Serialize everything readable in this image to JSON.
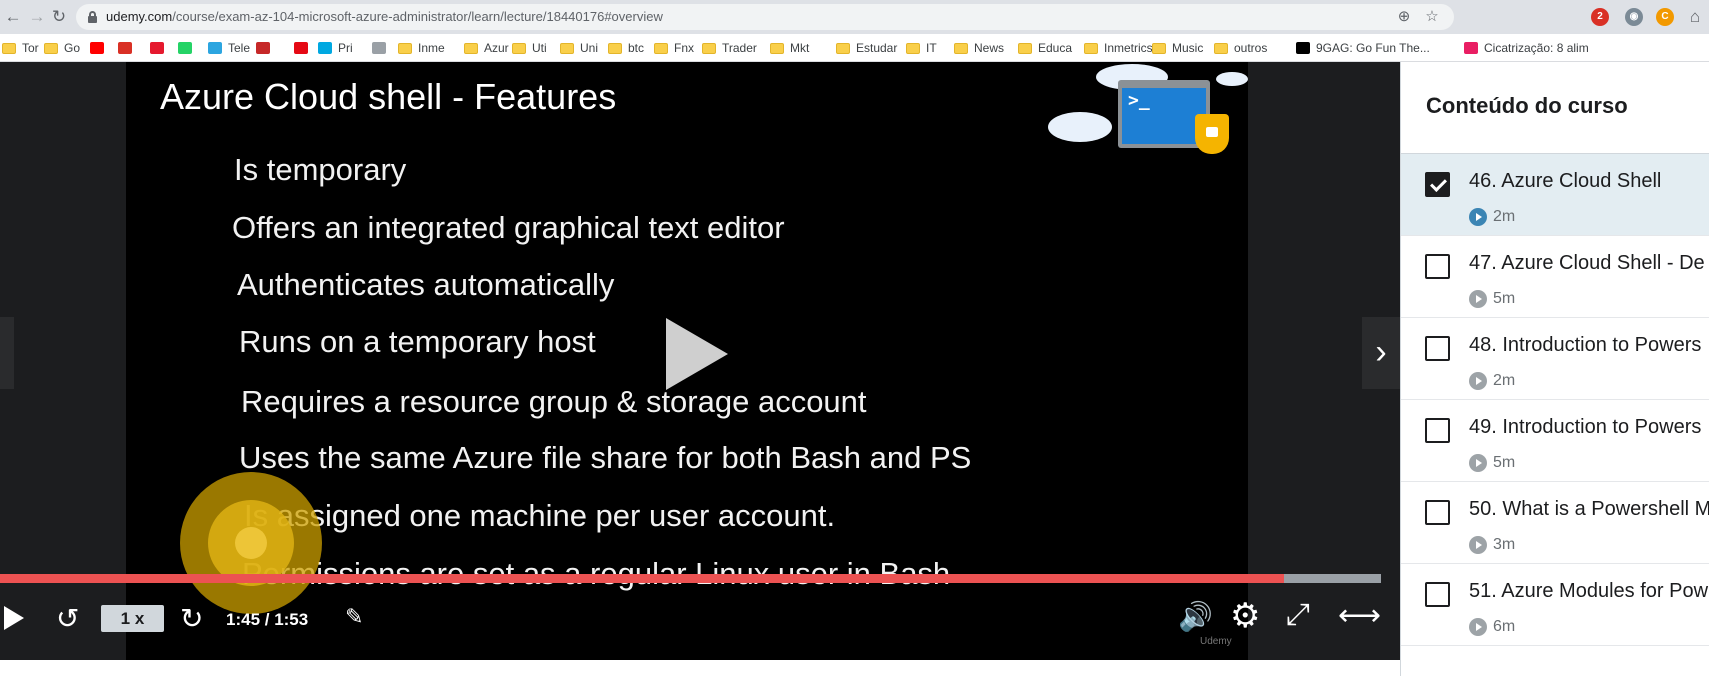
{
  "browser": {
    "url_host": "udemy.com",
    "url_path": "/course/exam-az-104-microsoft-azure-administrator/learn/lecture/18440176#overview",
    "extension_badge": "2",
    "bookmarks": [
      {
        "label": "Tor",
        "icon": "folder"
      },
      {
        "label": "Go",
        "icon": "folder"
      },
      {
        "label": "",
        "icon": "youtube-icon"
      },
      {
        "label": "",
        "icon": "gmail-icon"
      },
      {
        "label": "",
        "icon": "video-icon"
      },
      {
        "label": "",
        "icon": "whatsapp-icon"
      },
      {
        "label": "Tele",
        "icon": "telegram-icon"
      },
      {
        "label": "",
        "icon": "simple-fx-icon"
      },
      {
        "label": "",
        "icon": "netflix-icon"
      },
      {
        "label": "Pri",
        "icon": "prime-icon"
      },
      {
        "label": "",
        "icon": "download-icon"
      },
      {
        "label": "Inme",
        "icon": "folder"
      },
      {
        "label": "Azur",
        "icon": "folder"
      },
      {
        "label": "Uti",
        "icon": "folder"
      },
      {
        "label": "Uni",
        "icon": "folder"
      },
      {
        "label": "btc",
        "icon": "folder"
      },
      {
        "label": "Fnx",
        "icon": "folder"
      },
      {
        "label": "Trader",
        "icon": "folder"
      },
      {
        "label": "Mkt",
        "icon": "folder"
      },
      {
        "label": "Estudar",
        "icon": "folder"
      },
      {
        "label": "IT",
        "icon": "folder"
      },
      {
        "label": "News",
        "icon": "folder"
      },
      {
        "label": "Educa",
        "icon": "folder"
      },
      {
        "label": "Inmetrics",
        "icon": "folder"
      },
      {
        "label": "Music",
        "icon": "folder"
      },
      {
        "label": "outros",
        "icon": "folder"
      },
      {
        "label": "9GAG: Go Fun The...",
        "icon": "ninegag-icon"
      },
      {
        "label": "Cicatrização: 8 alim",
        "icon": "s-icon"
      }
    ]
  },
  "slide": {
    "title": "Azure Cloud shell - Features",
    "bullets": [
      "Is temporary",
      "Offers an integrated graphical text editor",
      "Authenticates automatically",
      "Runs on a temporary host",
      "Requires a resource group & storage account",
      "Uses the same Azure file share for both Bash and PS",
      "Is assigned one machine per user account.",
      "Permissions are set as a regular Linux user in Bash"
    ],
    "shell_prompt": ">_"
  },
  "player": {
    "speed": "1 x",
    "time": "1:45 / 1:53",
    "progress_fraction": 0.93,
    "udemy_watermark": "Udemy"
  },
  "sidebar": {
    "title": "Conteúdo do curso",
    "lectures": [
      {
        "title": "46. Azure Cloud Shell",
        "duration": "2m",
        "checked": true,
        "active": true
      },
      {
        "title": "47. Azure Cloud Shell - De",
        "duration": "5m",
        "checked": false,
        "active": false
      },
      {
        "title": "48. Introduction to Powers",
        "duration": "2m",
        "checked": false,
        "active": false
      },
      {
        "title": "49. Introduction to Powers",
        "duration": "5m",
        "checked": false,
        "active": false
      },
      {
        "title": "50. What is a Powershell M",
        "duration": "3m",
        "checked": false,
        "active": false
      },
      {
        "title": "51. Azure Modules for Pow",
        "duration": "6m",
        "checked": false,
        "active": false
      }
    ]
  },
  "colors": {
    "progress": "#ec5252",
    "accent": "#1c1d1f",
    "active_row": "#e3edf2"
  }
}
